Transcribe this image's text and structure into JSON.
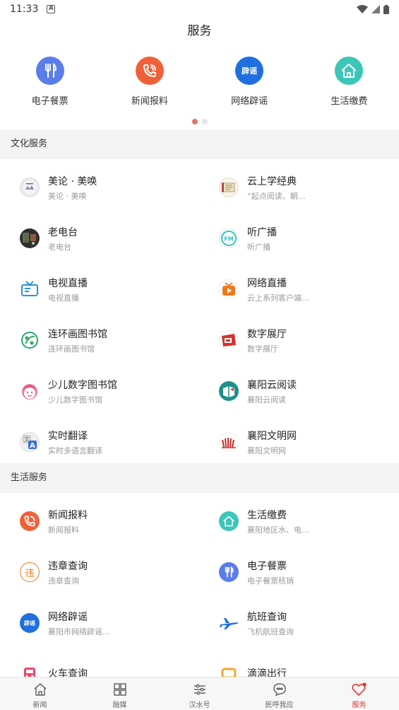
{
  "status": {
    "time": "11:33",
    "indicator": "A"
  },
  "header": {
    "title": "服务"
  },
  "top_services": [
    {
      "label": "电子餐票",
      "icon": "fork-knife-icon",
      "color": "#5b7de8"
    },
    {
      "label": "新闻报料",
      "icon": "phone-icon",
      "color": "#f0603a"
    },
    {
      "label": "网络辟谣",
      "icon": "rumor-badge-icon",
      "badge": "辟谣",
      "color": "#1f6fe0"
    },
    {
      "label": "生活缴费",
      "icon": "house-icon",
      "color": "#3cc6b8"
    }
  ],
  "pager": {
    "count": 2,
    "active": 0
  },
  "sections": [
    {
      "title": "文化服务",
      "items": [
        {
          "title": "美论 · 美唤",
          "sub": "美论 · 美唤",
          "icon": "meilun-logo-icon"
        },
        {
          "title": "云上学经典",
          "sub": "“起点阅读、朝…",
          "icon": "scroll-icon"
        },
        {
          "title": "老电台",
          "sub": "老电台",
          "icon": "old-radio-icon"
        },
        {
          "title": "听广播",
          "sub": "听广播",
          "icon": "fm-radio-icon"
        },
        {
          "title": "电视直播",
          "sub": "电视直播",
          "icon": "tv-icon"
        },
        {
          "title": "网络直播",
          "sub": "云上系列客户端…",
          "icon": "play-icon"
        },
        {
          "title": "连环画图书馆",
          "sub": "连环画图书馆",
          "icon": "palette-icon"
        },
        {
          "title": "数字展厅",
          "sub": "数字展厅",
          "icon": "gallery-icon"
        },
        {
          "title": "少儿数字图书馆",
          "sub": "少儿数字图书馆",
          "icon": "child-face-icon"
        },
        {
          "title": "襄阳云阅读",
          "sub": "襄阳云阅读",
          "icon": "book-icon"
        },
        {
          "title": "实时翻译",
          "sub": "实时多语言翻译",
          "icon": "translate-icon"
        },
        {
          "title": "襄阳文明网",
          "sub": "襄阳文明网",
          "icon": "civilization-icon"
        }
      ]
    },
    {
      "title": "生活服务",
      "items": [
        {
          "title": "新闻报料",
          "sub": "新闻报料",
          "icon": "phone-icon"
        },
        {
          "title": "生活缴费",
          "sub": "襄阳地区水、电…",
          "icon": "house-icon"
        },
        {
          "title": "违章查询",
          "sub": "违章查询",
          "icon": "violation-icon",
          "badge": "违"
        },
        {
          "title": "电子餐票",
          "sub": "电子餐票核销",
          "icon": "fork-knife-icon"
        },
        {
          "title": "网络辟谣",
          "sub": "襄阳市网络辟谣…",
          "icon": "rumor-badge-icon",
          "badge": "辟谣"
        },
        {
          "title": "航班查询",
          "sub": "飞机航班查询",
          "icon": "airplane-icon"
        },
        {
          "title": "火车查询",
          "sub": "",
          "icon": "train-icon"
        },
        {
          "title": "滴滴出行",
          "sub": "",
          "icon": "didi-icon"
        }
      ]
    }
  ],
  "tabs": [
    {
      "label": "新闻",
      "icon": "home-icon"
    },
    {
      "label": "融媒",
      "icon": "grid-icon"
    },
    {
      "label": "汉水号",
      "icon": "sliders-icon"
    },
    {
      "label": "民呼我应",
      "icon": "chat-icon"
    },
    {
      "label": "服务",
      "icon": "heart-icon",
      "active": true
    }
  ]
}
